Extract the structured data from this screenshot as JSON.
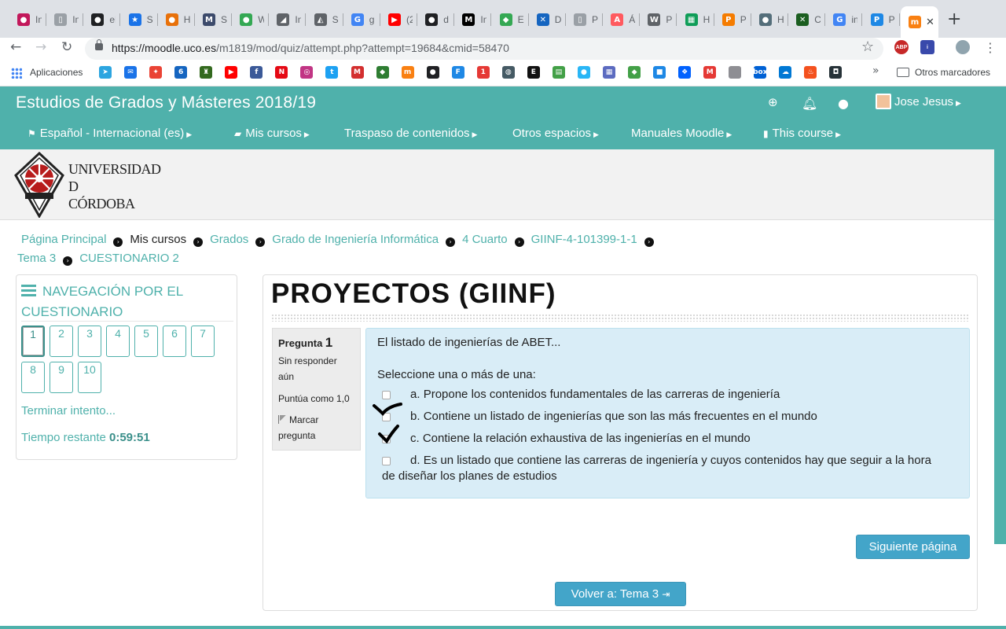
{
  "browser": {
    "tabs": [
      {
        "fav_text": "●",
        "fav_color": "#c2185b",
        "title": "In"
      },
      {
        "fav_text": "▯",
        "fav_color": "#9aa0a6",
        "title": "In"
      },
      {
        "fav_text": "●",
        "fav_color": "#202124",
        "title": "el"
      },
      {
        "fav_text": "★",
        "fav_color": "#1a73e8",
        "title": "S"
      },
      {
        "fav_text": "●",
        "fav_color": "#e8710a",
        "title": "H"
      },
      {
        "fav_text": "M",
        "fav_color": "#3c4a6b",
        "title": "S"
      },
      {
        "fav_text": "●",
        "fav_color": "#34a853",
        "title": "W"
      },
      {
        "fav_text": "◢",
        "fav_color": "#5f6368",
        "title": "In"
      },
      {
        "fav_text": "◭",
        "fav_color": "#5f6368",
        "title": "S"
      },
      {
        "fav_text": "G",
        "fav_color": "#4285f4",
        "title": "g"
      },
      {
        "fav_text": "▶",
        "fav_color": "#ff0000",
        "title": "(2"
      },
      {
        "fav_text": "●",
        "fav_color": "#202124",
        "title": "d"
      },
      {
        "fav_text": "M",
        "fav_color": "#000000",
        "title": "In"
      },
      {
        "fav_text": "◆",
        "fav_color": "#34a853",
        "title": "E"
      },
      {
        "fav_text": "✕",
        "fav_color": "#1565c0",
        "title": "D"
      },
      {
        "fav_text": "▯",
        "fav_color": "#9aa0a6",
        "title": "P"
      },
      {
        "fav_text": "A",
        "fav_color": "#ff5a5f",
        "title": "Á"
      },
      {
        "fav_text": "W",
        "fav_color": "#5f6368",
        "title": "P"
      },
      {
        "fav_text": "▦",
        "fav_color": "#0f9d58",
        "title": "H"
      },
      {
        "fav_text": "P",
        "fav_color": "#f57c00",
        "title": "P"
      },
      {
        "fav_text": "●",
        "fav_color": "#546e7a",
        "title": "H"
      },
      {
        "fav_text": "✕",
        "fav_color": "#1b5e20",
        "title": "C"
      },
      {
        "fav_text": "G",
        "fav_color": "#4285f4",
        "title": "in"
      },
      {
        "fav_text": "P",
        "fav_color": "#1e88e5",
        "title": "P"
      }
    ],
    "active_tab": {
      "fav_text": "m",
      "fav_color": "#f98012",
      "close": "✕"
    },
    "new_tab": "+",
    "url_host": "https://moodle.uco.es",
    "url_path": "/m1819/mod/quiz/attempt.php?attempt=19684&cmid=58470",
    "extensions": [
      {
        "label": "ABP",
        "color": "#c62828"
      },
      {
        "label": "i",
        "color": "#3949ab"
      },
      {
        "label": "",
        "color": "#90a4ae"
      }
    ],
    "bookmarks_apps": "Aplicaciones",
    "bookmark_icons": [
      {
        "t": "➤",
        "c": "#2ca5e0"
      },
      {
        "t": "✉",
        "c": "#1a73e8"
      },
      {
        "t": "✦",
        "c": "#ea4335"
      },
      {
        "t": "6",
        "c": "#1565c0"
      },
      {
        "t": "♜",
        "c": "#33691e"
      },
      {
        "t": "▶",
        "c": "#ff0000"
      },
      {
        "t": "f",
        "c": "#3b5998"
      },
      {
        "t": "N",
        "c": "#e50914"
      },
      {
        "t": "◎",
        "c": "#c13584"
      },
      {
        "t": "t",
        "c": "#1da1f2"
      },
      {
        "t": "M",
        "c": "#d32f2f"
      },
      {
        "t": "◆",
        "c": "#2e7d32"
      },
      {
        "t": "m",
        "c": "#f98012"
      },
      {
        "t": "●",
        "c": "#202124"
      },
      {
        "t": "F",
        "c": "#1e88e5"
      },
      {
        "t": "1",
        "c": "#e53935"
      },
      {
        "t": "◍",
        "c": "#455a64"
      },
      {
        "t": "E",
        "c": "#111111"
      },
      {
        "t": "▤",
        "c": "#43a047"
      },
      {
        "t": "●",
        "c": "#29b6f6"
      },
      {
        "t": "▦",
        "c": "#5c6bc0"
      },
      {
        "t": "◆",
        "c": "#43a047"
      },
      {
        "t": "■",
        "c": "#1e88e5"
      },
      {
        "t": "❖",
        "c": "#0061fe"
      },
      {
        "t": "M",
        "c": "#e53935"
      },
      {
        "t": "",
        "c": "#8e8e93"
      },
      {
        "t": "box",
        "c": "#0061d5"
      },
      {
        "t": "☁",
        "c": "#0078d4"
      },
      {
        "t": "♨",
        "c": "#f4511e"
      },
      {
        "t": "◘",
        "c": "#263238"
      }
    ],
    "bookmarks_more": "»",
    "bookmarks_other": "Otros marcadores"
  },
  "header": {
    "site_title": "Estudios de Grados y Másteres 2018/19",
    "user_name": "Jose Jesus",
    "menu": [
      {
        "icon": "⚑",
        "label": "Español - Internacional (es)"
      },
      {
        "icon": "▰",
        "label": "Mis cursos"
      },
      {
        "icon": "",
        "label": "Traspaso de contenidos"
      },
      {
        "icon": "",
        "label": "Otros espacios"
      },
      {
        "icon": "",
        "label": "Manuales Moodle"
      },
      {
        "icon": "▮",
        "label": "This course"
      }
    ]
  },
  "logo": {
    "line1": "UNIVERSIDAD",
    "line2": "D",
    "line3": "CÓRDOBA"
  },
  "breadcrumb": [
    {
      "label": "Página Principal",
      "link": true
    },
    {
      "label": "Mis cursos",
      "link": false
    },
    {
      "label": "Grados",
      "link": true
    },
    {
      "label": "Grado de Ingeniería Informática",
      "link": true
    },
    {
      "label": "4 Cuarto",
      "link": true
    },
    {
      "label": "GIINF-4-101399-1-1",
      "link": true
    },
    {
      "label": "Tema 3",
      "link": true
    },
    {
      "label": "CUESTIONARIO 2",
      "link": true
    }
  ],
  "quiz_nav": {
    "title": "NAVEGACIÓN POR EL CUESTIONARIO",
    "questions": [
      "1",
      "2",
      "3",
      "4",
      "5",
      "6",
      "7",
      "8",
      "9",
      "10"
    ],
    "current": "1",
    "finish": "Terminar intento...",
    "timer_label": "Tiempo restante",
    "timer_value": "0:59:51"
  },
  "main": {
    "title": "PROYECTOS (GIINF)",
    "question": {
      "label": "Pregunta",
      "number": "1",
      "status": "Sin responder aún",
      "marks": "Puntúa como 1,0",
      "flag": "Marcar pregunta",
      "text": "El listado de ingenierías de ABET...",
      "prompt": "Seleccione una o más de una:",
      "options": [
        {
          "letter": "a.",
          "text": "Propone los contenidos fundamentales de las carreras de ingeniería",
          "checked": false
        },
        {
          "letter": "b.",
          "text": "Contiene un listado de ingenierías que son las más frecuentes en el mundo",
          "checked": false
        },
        {
          "letter": "c.",
          "text": "Contiene la relación exhaustiva de las ingenierías en el mundo",
          "checked": false
        },
        {
          "letter": "d.",
          "text": "Es un listado que contiene las carreras de ingeniería y cuyos contenidos hay que seguir a la hora de diseñar los planes de estudios",
          "checked": false
        }
      ]
    },
    "next_button": "Siguiente página",
    "back_button": "Volver a: Tema 3"
  },
  "colors": {
    "theme": "#4fb1ab",
    "button": "#43a5c9",
    "question_bg": "#d9edf7"
  }
}
